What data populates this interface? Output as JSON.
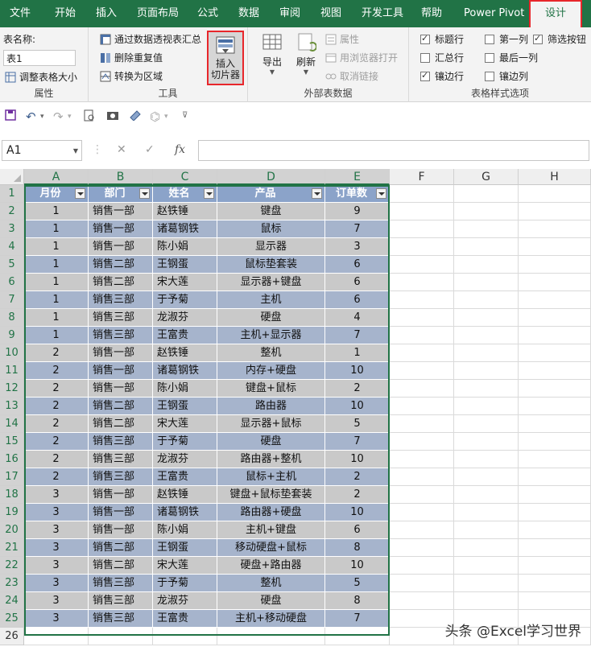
{
  "ribbon_tabs": [
    "文件",
    "开始",
    "插入",
    "页面布局",
    "公式",
    "数据",
    "审阅",
    "视图",
    "开发工具",
    "帮助",
    "Power Pivot",
    "设计"
  ],
  "active_tab": "设计",
  "ribbon": {
    "properties": {
      "table_name_label": "表名称:",
      "table_name_value": "表1",
      "resize_label": "调整表格大小",
      "group_label": "属性"
    },
    "tools": {
      "pivot_summary": "通过数据透视表汇总",
      "remove_duplicates": "删除重复值",
      "convert_range": "转换为区域",
      "insert_slicer_line1": "插入",
      "insert_slicer_line2": "切片器",
      "group_label": "工具"
    },
    "external": {
      "export": "导出",
      "refresh": "刷新",
      "properties": "属性",
      "open_browser": "用浏览器打开",
      "unlink": "取消链接",
      "group_label": "外部表数据"
    },
    "style_options": {
      "header_row": "标题行",
      "total_row": "汇总行",
      "banded_rows": "镶边行",
      "first_column": "第一列",
      "last_column": "最后一列",
      "banded_columns": "镶边列",
      "filter_button": "筛选按钮",
      "group_label": "表格样式选项",
      "checked": {
        "header_row": true,
        "total_row": false,
        "banded_rows": true,
        "first_column": false,
        "last_column": false,
        "banded_columns": false,
        "filter_button": true
      }
    }
  },
  "formula_bar": {
    "name_box": "A1",
    "fx": "fx",
    "value": ""
  },
  "columns": [
    "A",
    "B",
    "C",
    "D",
    "E",
    "F",
    "G",
    "H"
  ],
  "table": {
    "headers": [
      "月份",
      "部门",
      "姓名",
      "产品",
      "订单数"
    ],
    "rows": [
      [
        "1",
        "销售一部",
        "赵铁锤",
        "键盘",
        "9"
      ],
      [
        "1",
        "销售一部",
        "诸葛钢铁",
        "鼠标",
        "7"
      ],
      [
        "1",
        "销售一部",
        "陈小娟",
        "显示器",
        "3"
      ],
      [
        "1",
        "销售二部",
        "王钢蛋",
        "鼠标垫套装",
        "6"
      ],
      [
        "1",
        "销售二部",
        "宋大莲",
        "显示器+键盘",
        "6"
      ],
      [
        "1",
        "销售三部",
        "于予菊",
        "主机",
        "6"
      ],
      [
        "1",
        "销售三部",
        "龙淑芬",
        "硬盘",
        "4"
      ],
      [
        "1",
        "销售三部",
        "王富贵",
        "主机+显示器",
        "7"
      ],
      [
        "2",
        "销售一部",
        "赵铁锤",
        "整机",
        "1"
      ],
      [
        "2",
        "销售一部",
        "诸葛钢铁",
        "内存+硬盘",
        "10"
      ],
      [
        "2",
        "销售一部",
        "陈小娟",
        "键盘+鼠标",
        "2"
      ],
      [
        "2",
        "销售二部",
        "王钢蛋",
        "路由器",
        "10"
      ],
      [
        "2",
        "销售二部",
        "宋大莲",
        "显示器+鼠标",
        "5"
      ],
      [
        "2",
        "销售三部",
        "于予菊",
        "硬盘",
        "7"
      ],
      [
        "2",
        "销售三部",
        "龙淑芬",
        "路由器+整机",
        "10"
      ],
      [
        "2",
        "销售三部",
        "王富贵",
        "鼠标+主机",
        "2"
      ],
      [
        "3",
        "销售一部",
        "赵铁锤",
        "键盘+鼠标垫套装",
        "2"
      ],
      [
        "3",
        "销售一部",
        "诸葛钢铁",
        "路由器+硬盘",
        "10"
      ],
      [
        "3",
        "销售一部",
        "陈小娟",
        "主机+键盘",
        "6"
      ],
      [
        "3",
        "销售二部",
        "王钢蛋",
        "移动硬盘+鼠标",
        "8"
      ],
      [
        "3",
        "销售二部",
        "宋大莲",
        "硬盘+路由器",
        "10"
      ],
      [
        "3",
        "销售三部",
        "于予菊",
        "整机",
        "5"
      ],
      [
        "3",
        "销售三部",
        "龙淑芬",
        "硬盘",
        "8"
      ],
      [
        "3",
        "销售三部",
        "王富贵",
        "主机+移动硬盘",
        "7"
      ]
    ]
  },
  "row_numbers": [
    "1",
    "2",
    "3",
    "4",
    "5",
    "6",
    "7",
    "8",
    "9",
    "10",
    "11",
    "12",
    "13",
    "14",
    "15",
    "16",
    "17",
    "18",
    "19",
    "20",
    "21",
    "22",
    "23",
    "24",
    "25",
    "26"
  ],
  "watermark": "头条 @Excel学习世界",
  "colors": {
    "accent": "#217346",
    "header_fill": "#8ba3c9",
    "band_blue": "#a6b4cc",
    "band_gray": "#c9c9c9",
    "highlight": "#e8262b"
  }
}
